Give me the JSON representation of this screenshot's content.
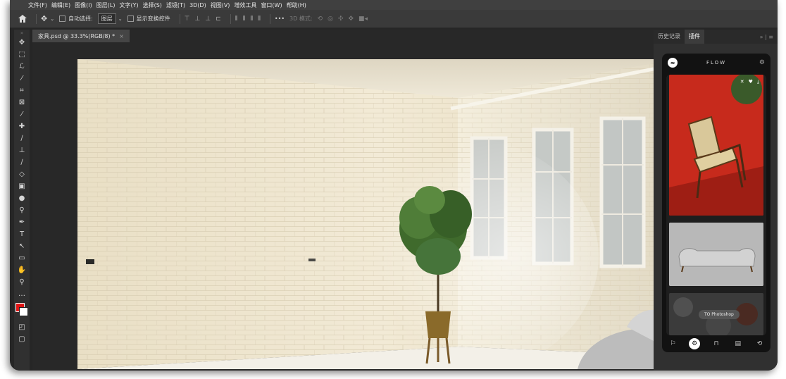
{
  "menubar": {
    "items": [
      "文件(F)",
      "编辑(E)",
      "图像(I)",
      "图层(L)",
      "文字(Y)",
      "选择(S)",
      "滤镜(T)",
      "3D(D)",
      "视图(V)",
      "增效工具",
      "窗口(W)",
      "帮助(H)"
    ]
  },
  "options": {
    "auto_select_label": "自动选择:",
    "auto_select_value": "图层",
    "show_transform_label": "显示变换控件",
    "more_label": "•••",
    "mode_3d_label": "3D 模式:"
  },
  "document": {
    "tab_title": "家具.psd @ 33.3%(RGB/8) *",
    "close_glyph": "×"
  },
  "panel": {
    "tabs": [
      "历史记录",
      "插件"
    ],
    "controls_glyph": "» | ≡"
  },
  "plugin": {
    "title": "FLOW",
    "logo_glyph": "≈",
    "pill_label": "TO Photoshop"
  },
  "colors": {
    "foreground": "#e01414",
    "background": "#ffffff",
    "ui_dark": "#262626",
    "accent_card": "#c8281e"
  },
  "icons": {
    "home": "home-icon",
    "move": "move-icon",
    "favorite": "heart-icon",
    "download": "download-icon",
    "close": "close-icon",
    "settings": "gear-icon"
  }
}
